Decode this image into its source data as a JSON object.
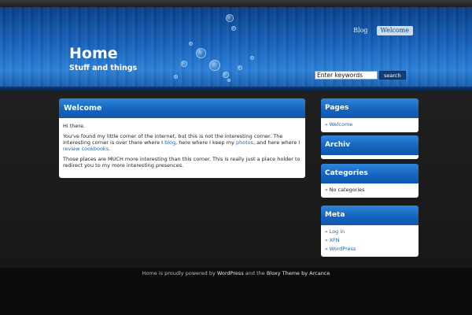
{
  "header": {
    "title": "Home",
    "tagline": "Stuff and things",
    "nav": [
      {
        "label": "Blog",
        "active": false
      },
      {
        "label": "Welcome",
        "active": true
      }
    ],
    "search": {
      "value": "Enter keywords",
      "button": "search"
    }
  },
  "main": {
    "title": "Welcome",
    "greeting": "Hi there.",
    "p1": {
      "t1": "You've found my little corner of the internet, but this is not the interesting corner.  The interesting corner is over there where I ",
      "l1": "blog",
      "t2": ", here where I keep my ",
      "l2": "photos",
      "t3": ", and here where I ",
      "l3": "review cookbooks",
      "t4": "."
    },
    "p2": "Those places are MUCH more interesting than this corner.  This is really just a place holder to redirect you to my more interesting presences."
  },
  "sidebar": {
    "pages": {
      "title": "Pages",
      "items": [
        "Welcome"
      ]
    },
    "archiv": {
      "title": "Archiv"
    },
    "categories": {
      "title": "Categories",
      "items": [
        "No categories"
      ]
    },
    "meta": {
      "title": "Meta",
      "items": [
        "Log in",
        "XFN",
        "WordPress"
      ]
    }
  },
  "footer": {
    "t1": "Home is proudly powered by ",
    "l1": "WordPress",
    "t2": " and the ",
    "l2": "Bloxy Theme by Arcance"
  },
  "colors": {
    "accent": "#1664bf",
    "link": "#1d64b8",
    "background": "#161616"
  }
}
